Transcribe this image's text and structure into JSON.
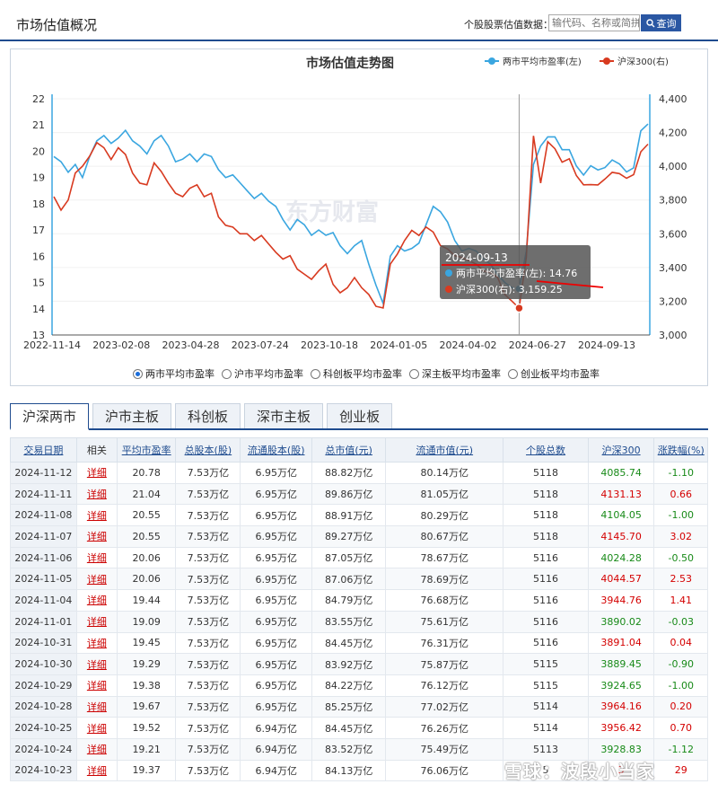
{
  "header": {
    "title": "市场估值概况",
    "search_label": "个股股票估值数据：",
    "search_placeholder": "输代码、名称或简拼",
    "search_button": "查询"
  },
  "chart_data": {
    "type": "line",
    "title": "市场估值走势图",
    "x_ticks": [
      "2022-11-14",
      "2023-02-08",
      "2023-04-28",
      "2023-07-24",
      "2023-10-18",
      "2024-01-05",
      "2024-04-02",
      "2024-06-27",
      "2024-09-13"
    ],
    "y_left": {
      "ticks": [
        "13",
        "14",
        "15",
        "16",
        "17",
        "18",
        "19",
        "20",
        "21",
        "22"
      ],
      "range": [
        13,
        22
      ]
    },
    "y_right": {
      "ticks": [
        "3,000",
        "3,200",
        "3,400",
        "3,600",
        "3,800",
        "4,000",
        "4,200",
        "4,400"
      ],
      "range": [
        3000,
        4400
      ]
    },
    "legend": [
      "两市平均市盈率(左)",
      "沪深300(右)"
    ],
    "colors": {
      "pe": "#3aa6e0",
      "csi": "#d83a20"
    },
    "series": [
      {
        "name": "两市平均市盈率(左)",
        "axis": "left",
        "values": [
          19.8,
          19.6,
          19.2,
          19.5,
          19.0,
          19.8,
          20.4,
          20.6,
          20.3,
          20.5,
          20.8,
          20.4,
          20.2,
          19.9,
          20.4,
          20.6,
          20.2,
          19.6,
          19.7,
          19.9,
          19.6,
          19.9,
          19.8,
          19.3,
          19.0,
          19.1,
          18.8,
          18.5,
          18.2,
          18.4,
          18.1,
          17.9,
          17.4,
          17.0,
          17.4,
          17.2,
          16.8,
          17.0,
          16.8,
          16.9,
          16.4,
          16.1,
          16.4,
          16.6,
          15.7,
          14.9,
          14.2,
          16.0,
          16.4,
          16.2,
          16.3,
          16.5,
          17.2,
          17.9,
          17.7,
          17.3,
          16.6,
          16.2,
          16.3,
          16.2,
          15.9,
          15.7,
          15.3,
          15.0,
          14.8,
          14.76,
          16.2,
          19.5,
          20.2,
          20.55,
          20.55,
          20.06,
          20.06,
          19.44,
          19.09,
          19.45,
          19.29,
          19.38,
          19.67,
          19.52,
          19.21,
          19.37,
          20.78,
          21.04
        ]
      },
      {
        "name": "沪深300(右)",
        "axis": "right",
        "values": [
          3820,
          3740,
          3800,
          3960,
          4000,
          4060,
          4140,
          4110,
          4040,
          4110,
          4070,
          3960,
          3900,
          3890,
          4020,
          3970,
          3900,
          3840,
          3820,
          3870,
          3890,
          3820,
          3840,
          3700,
          3650,
          3640,
          3600,
          3600,
          3560,
          3590,
          3540,
          3490,
          3450,
          3470,
          3390,
          3360,
          3330,
          3380,
          3420,
          3300,
          3250,
          3280,
          3340,
          3280,
          3240,
          3170,
          3160,
          3420,
          3480,
          3560,
          3620,
          3590,
          3640,
          3610,
          3530,
          3510,
          3470,
          3460,
          3440,
          3420,
          3380,
          3370,
          3340,
          3240,
          3200,
          3159.25,
          3460,
          4180,
          3900,
          4145.7,
          4104.05,
          4024.28,
          4044.57,
          3944.76,
          3890.02,
          3891.04,
          3889.45,
          3924.65,
          3964.16,
          3956.42,
          3928.83,
          3950,
          4085.74,
          4131.13
        ]
      }
    ],
    "tooltip": {
      "date": "2024-09-13",
      "pe_label": "两市平均市盈率(左): 14.76",
      "csi_label": "沪深300(右): 3,159.25"
    },
    "watermark": "东方财富"
  },
  "radios": [
    {
      "label": "两市平均市盈率",
      "checked": true
    },
    {
      "label": "沪市平均市盈率",
      "checked": false
    },
    {
      "label": "科创板平均市盈率",
      "checked": false
    },
    {
      "label": "深主板平均市盈率",
      "checked": false
    },
    {
      "label": "创业板平均市盈率",
      "checked": false
    }
  ],
  "tabs": [
    "沪深两市",
    "沪市主板",
    "科创板",
    "深市主板",
    "创业板"
  ],
  "table": {
    "headers": [
      "交易日期",
      "相关",
      "平均市盈率",
      "总股本(股)",
      "流通股本(股)",
      "总市值(元)",
      "流通市值(元)",
      "个股总数",
      "沪深300",
      "涨跌幅(%)"
    ],
    "rows": [
      [
        "2024-11-12",
        "详细",
        "20.78",
        "7.53万亿",
        "6.95万亿",
        "88.82万亿",
        "80.14万亿",
        "5118",
        "4085.74",
        "-1.10"
      ],
      [
        "2024-11-11",
        "详细",
        "21.04",
        "7.53万亿",
        "6.95万亿",
        "89.86万亿",
        "81.05万亿",
        "5118",
        "4131.13",
        "0.66"
      ],
      [
        "2024-11-08",
        "详细",
        "20.55",
        "7.53万亿",
        "6.95万亿",
        "88.91万亿",
        "80.29万亿",
        "5118",
        "4104.05",
        "-1.00"
      ],
      [
        "2024-11-07",
        "详细",
        "20.55",
        "7.53万亿",
        "6.95万亿",
        "89.27万亿",
        "80.67万亿",
        "5118",
        "4145.70",
        "3.02"
      ],
      [
        "2024-11-06",
        "详细",
        "20.06",
        "7.53万亿",
        "6.95万亿",
        "87.05万亿",
        "78.67万亿",
        "5116",
        "4024.28",
        "-0.50"
      ],
      [
        "2024-11-05",
        "详细",
        "20.06",
        "7.53万亿",
        "6.95万亿",
        "87.06万亿",
        "78.69万亿",
        "5116",
        "4044.57",
        "2.53"
      ],
      [
        "2024-11-04",
        "详细",
        "19.44",
        "7.53万亿",
        "6.95万亿",
        "84.79万亿",
        "76.68万亿",
        "5116",
        "3944.76",
        "1.41"
      ],
      [
        "2024-11-01",
        "详细",
        "19.09",
        "7.53万亿",
        "6.95万亿",
        "83.55万亿",
        "75.61万亿",
        "5116",
        "3890.02",
        "-0.03"
      ],
      [
        "2024-10-31",
        "详细",
        "19.45",
        "7.53万亿",
        "6.95万亿",
        "84.45万亿",
        "76.31万亿",
        "5116",
        "3891.04",
        "0.04"
      ],
      [
        "2024-10-30",
        "详细",
        "19.29",
        "7.53万亿",
        "6.95万亿",
        "83.92万亿",
        "75.87万亿",
        "5115",
        "3889.45",
        "-0.90"
      ],
      [
        "2024-10-29",
        "详细",
        "19.38",
        "7.53万亿",
        "6.95万亿",
        "84.22万亿",
        "76.12万亿",
        "5115",
        "3924.65",
        "-1.00"
      ],
      [
        "2024-10-28",
        "详细",
        "19.67",
        "7.53万亿",
        "6.95万亿",
        "85.25万亿",
        "77.02万亿",
        "5114",
        "3964.16",
        "0.20"
      ],
      [
        "2024-10-25",
        "详细",
        "19.52",
        "7.53万亿",
        "6.94万亿",
        "84.45万亿",
        "76.26万亿",
        "5114",
        "3956.42",
        "0.70"
      ],
      [
        "2024-10-24",
        "详细",
        "19.21",
        "7.53万亿",
        "6.94万亿",
        "83.52万亿",
        "75.49万亿",
        "5113",
        "3928.83",
        "-1.12"
      ],
      [
        "2024-10-23",
        "详细",
        "19.37",
        "7.53万亿",
        "6.94万亿",
        "84.13万亿",
        "76.06万亿",
        "5",
        "3",
        "29"
      ]
    ]
  },
  "footer_watermark": "雪球：波段小当家"
}
